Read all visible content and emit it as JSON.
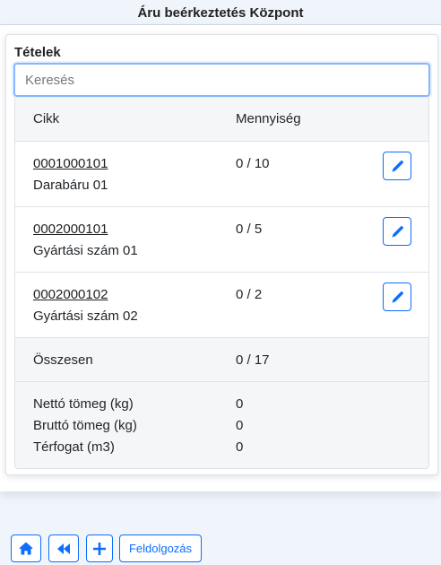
{
  "app": {
    "title": "Áru beérkeztetés Központ"
  },
  "section": {
    "title": "Tételek"
  },
  "search": {
    "placeholder": "Keresés",
    "value": ""
  },
  "table": {
    "headers": {
      "item": "Cikk",
      "quantity": "Mennyiség"
    },
    "rows": [
      {
        "code": "0001000101",
        "name": "Darabáru 01",
        "qty": "0 / 10"
      },
      {
        "code": "0002000101",
        "name": "Gyártási szám 01",
        "qty": "0 / 5"
      },
      {
        "code": "0002000102",
        "name": "Gyártási szám 02",
        "qty": "0 / 2"
      }
    ],
    "total": {
      "label": "Összesen",
      "value": "0 / 17"
    },
    "summary": [
      {
        "label": "Nettó tömeg (kg)",
        "value": "0"
      },
      {
        "label": "Bruttó tömeg (kg)",
        "value": "0"
      },
      {
        "label": "Térfogat (m3)",
        "value": "0"
      }
    ]
  },
  "toolbar": {
    "home_icon": "home-icon",
    "back_icon": "rewind-icon",
    "add_icon": "plus-icon",
    "process_label": "Feldolgozás"
  },
  "colors": {
    "accent": "#0d6efd",
    "background": "#f0f4fb"
  }
}
